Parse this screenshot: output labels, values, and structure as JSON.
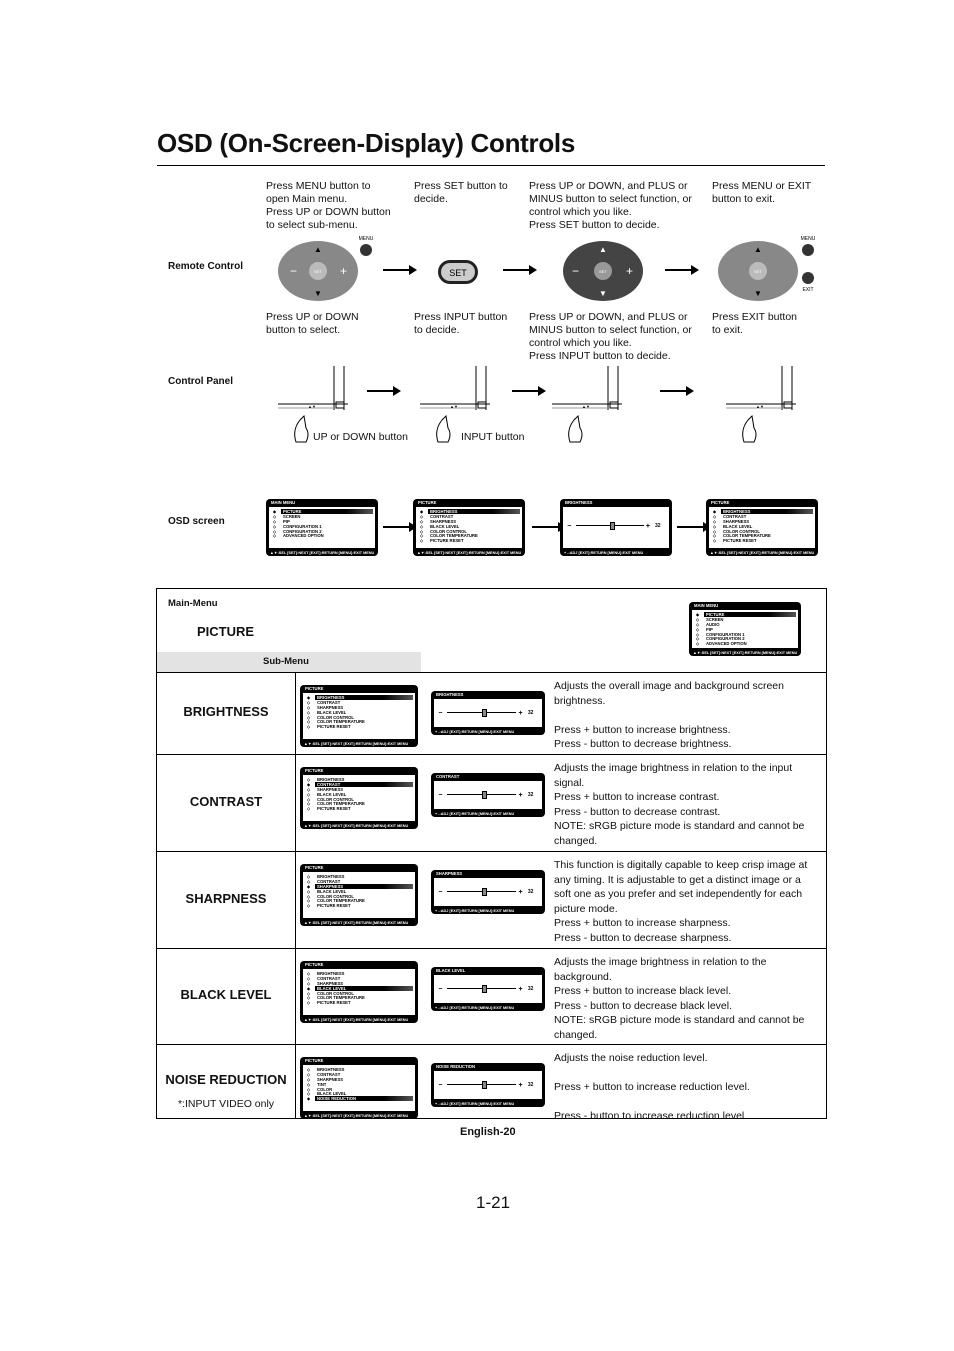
{
  "title": "OSD (On-Screen-Display) Controls",
  "labels": {
    "remote": "Remote Control",
    "panel": "Control Panel",
    "osd": "OSD screen"
  },
  "remote_steps": [
    "Press MENU button to\nopen Main menu.\nPress UP or DOWN button\nto select sub-menu.",
    "Press SET button to\ndecide.",
    "Press UP or DOWN, and PLUS or\nMINUS button to select function, or\ncontrol which you like.\nPress SET button to decide.",
    "Press MENU or EXIT\nbutton to exit."
  ],
  "panel_steps": [
    "Press UP or DOWN\nbutton to select.",
    "Press INPUT button\nto decide.",
    "Press UP or DOWN, and PLUS or\nMINUS button to select function, or\ncontrol which you like.\nPress INPUT button to decide.",
    "Press EXIT button\nto exit."
  ],
  "remote_buttons": {
    "set": "SET",
    "menu": "MENU",
    "exit": "EXIT"
  },
  "hand_labels": [
    "UP or DOWN button",
    "INPUT button"
  ],
  "footer_menu": "▲▼:SEL [SET]:NEXT [EXIT]:RETURN [MENU]:EXIT MENU",
  "footer_adj": "+ -:ADJ  [EXIT]:RETURN  [MENU]:EXIT MENU",
  "picture_items": [
    "BRIGHTNESS",
    "CONTRAST",
    "SHARPNESS",
    "BLACK LEVEL",
    "COLOR CONTROL",
    "COLOR TEMPERATURE",
    "PICTURE RESET"
  ],
  "osd_row": [
    {
      "type": "menu",
      "title": "MAIN MENU",
      "items": [
        "PICTURE",
        "SCREEN",
        "PIP",
        "CONFIGURATION 1",
        "CONFIGURATION 2",
        "ADVANCED OPTION"
      ],
      "selected": 0
    },
    {
      "type": "menu",
      "title": "PICTURE",
      "items": [
        "BRIGHTNESS",
        "CONTRAST",
        "SHARPNESS",
        "BLACK LEVEL",
        "COLOR CONTROL",
        "COLOR TEMPERATURE",
        "PICTURE RESET"
      ],
      "selected": 0
    },
    {
      "type": "slider",
      "title": "BRIGHTNESS",
      "value": 32
    },
    {
      "type": "menu",
      "title": "PICTURE",
      "items": [
        "BRIGHTNESS",
        "CONTRAST",
        "SHARPNESS",
        "BLACK LEVEL",
        "COLOR CONTROL",
        "COLOR TEMPERATURE",
        "PICTURE RESET"
      ],
      "selected": 0
    }
  ],
  "table": {
    "main_menu_label": "Main-Menu",
    "picture": "PICTURE",
    "sub_menu_label": "Sub-Menu",
    "main_osd": {
      "type": "menu",
      "title": "MAIN MENU",
      "items": [
        "PICTURE",
        "SCREEN",
        "AUDIO",
        "PIP",
        "CONFIGURATION 1",
        "CONFIGURATION 2",
        "ADVANCED OPTION"
      ],
      "selected": 0
    },
    "rows": [
      {
        "label": "BRIGHTNESS",
        "selected": 0,
        "desc": "Adjusts the overall image and background screen brightness.\n\nPress + button to increase brightness.\nPress - button to decrease brightness.",
        "value": 32
      },
      {
        "label": "CONTRAST",
        "selected": 1,
        "desc": "Adjusts the image brightness in relation to the input signal.\nPress + button to increase contrast.\nPress - button to decrease contrast.\nNOTE: sRGB picture mode is standard and cannot be changed.",
        "value": 32
      },
      {
        "label": "SHARPNESS",
        "selected": 2,
        "desc": "This function is digitally capable to keep crisp image at any timing. It is adjustable to get a distinct image or a soft one as you prefer and set independently for each picture mode.\nPress + button to increase sharpness.\nPress - button to decrease sharpness.",
        "value": 32
      },
      {
        "label": "BLACK LEVEL",
        "selected": 3,
        "desc": "Adjusts the image brightness in relation to the background.\nPress + button to increase black level.\nPress - button to decrease black level.\nNOTE: sRGB picture mode is standard and cannot be changed.",
        "value": 32
      },
      {
        "label": "NOISE REDUCTION",
        "note": "*:INPUT VIDEO only",
        "items": [
          "BRIGHTNESS",
          "CONTRAST",
          "SHARPNESS",
          "TINT",
          "COLOR",
          "BLACK LEVEL",
          "NOISE REDUCTION"
        ],
        "selected": 6,
        "desc": "Adjusts the noise reduction level.\n\nPress + button to increase reduction level.\n\nPress - button to increase reduction level.",
        "value": 32
      }
    ]
  },
  "page_footer": "English-20",
  "page_number": "1-21"
}
